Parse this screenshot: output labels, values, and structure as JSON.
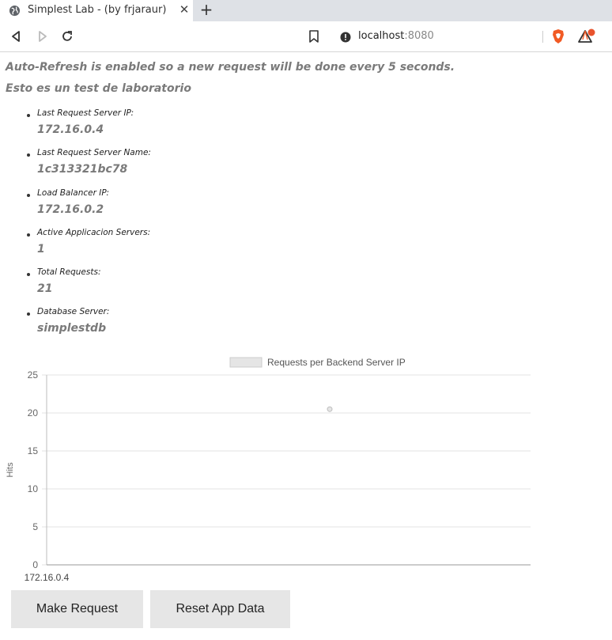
{
  "browser": {
    "tab_title": "Simplest Lab - (by frjaraur)",
    "tab_close": "✕",
    "new_tab": "+",
    "url_host": "localhost",
    "url_port": ":8080"
  },
  "page": {
    "autorefresh_message": "Auto-Refresh is enabled so a new request will be done every 5 seconds.",
    "subtitle": "Esto es un test de laboratorio",
    "info": [
      {
        "label": "Last Request Server IP:",
        "value": "172.16.0.4"
      },
      {
        "label": "Last Request Server Name:",
        "value": "1c313321bc78"
      },
      {
        "label": "Load Balancer IP:",
        "value": "172.16.0.2"
      },
      {
        "label": "Active Applicacion Servers:",
        "value": "1"
      },
      {
        "label": "Total Requests:",
        "value": "21"
      },
      {
        "label": "Database Server:",
        "value": "simplestdb"
      }
    ],
    "buttons": {
      "make_request": "Make Request",
      "reset_app_data": "Reset App Data"
    }
  },
  "chart_data": {
    "type": "line",
    "categories": [
      "172.16.0.4"
    ],
    "series": [
      {
        "name": "Requests per Backend Server IP",
        "values": [
          20.5
        ]
      }
    ],
    "ylabel": "Hits",
    "xlabel": "",
    "ylim": [
      0,
      25
    ],
    "yticks": [
      0,
      5,
      10,
      15,
      20,
      25
    ],
    "grid": true,
    "legend": "top",
    "colors": {
      "line": "#cccccc",
      "point_fill": "#e5e5e5",
      "grid": "#e3e3e3"
    }
  }
}
